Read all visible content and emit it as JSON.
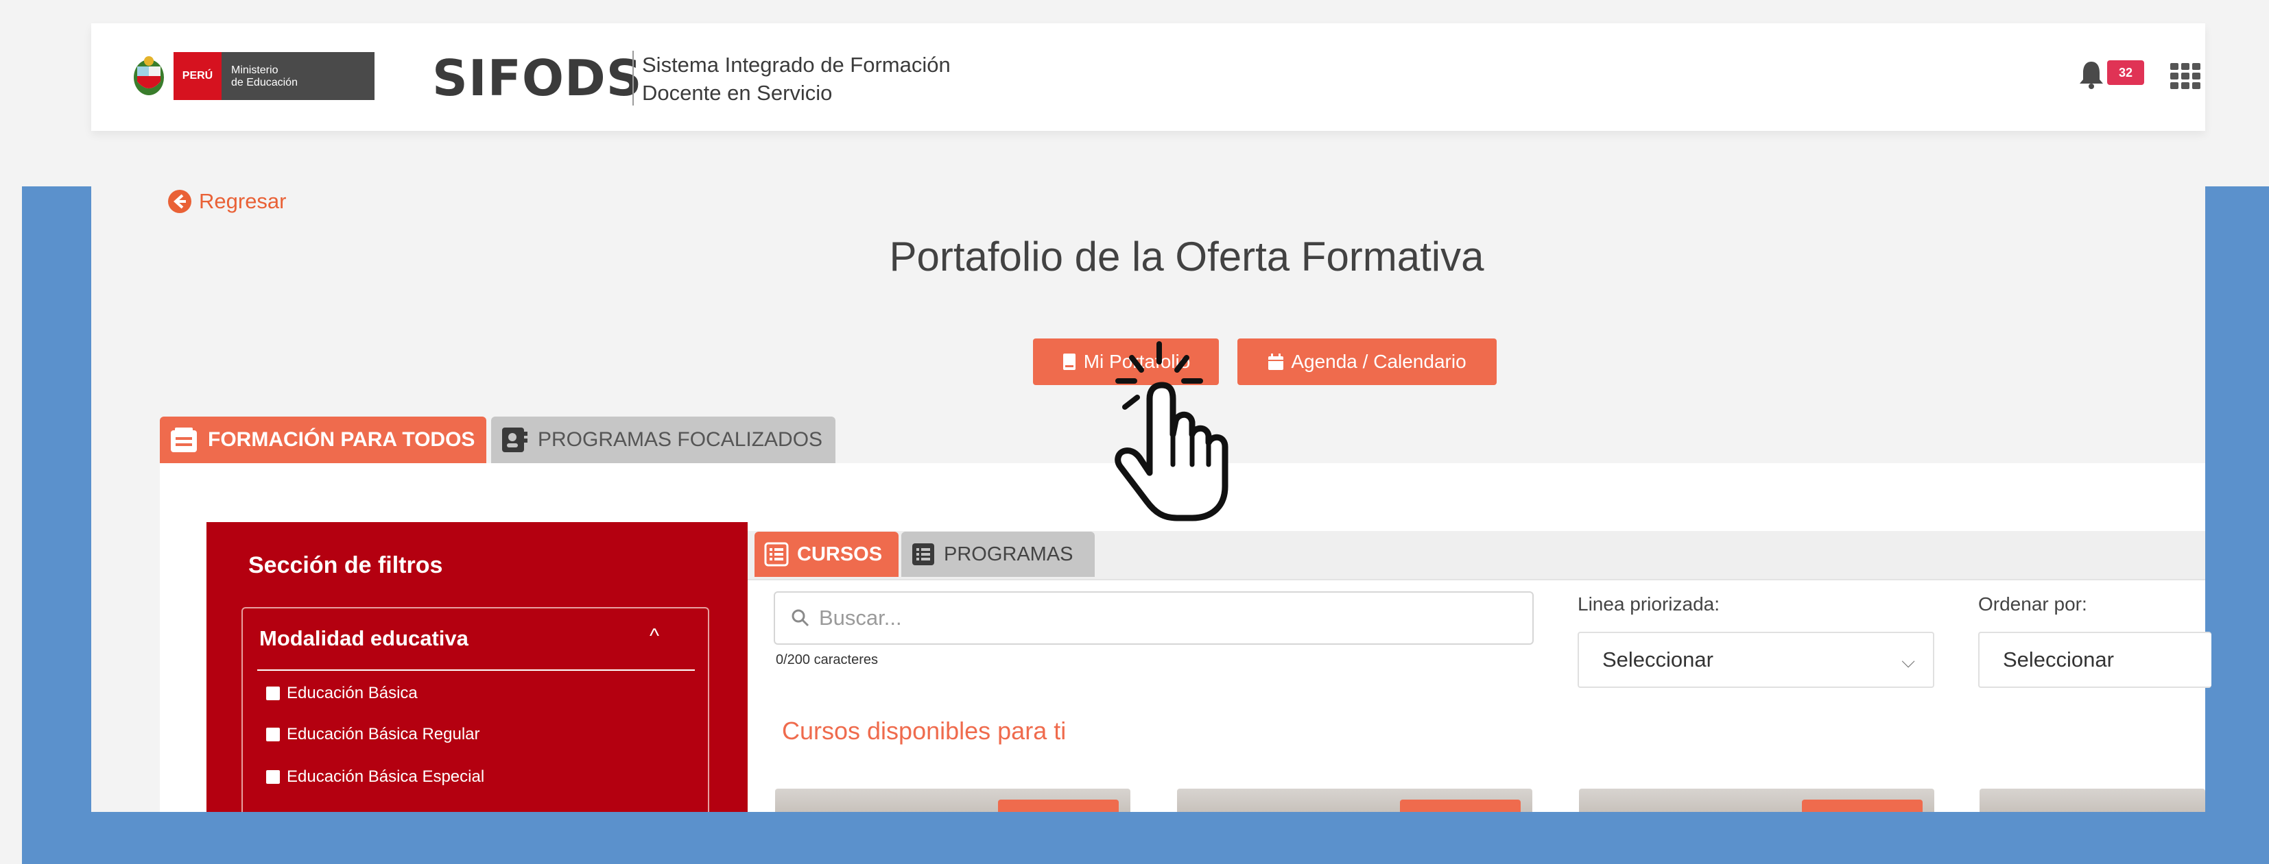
{
  "header": {
    "country": "PERÚ",
    "ministry_line1": "Ministerio",
    "ministry_line2": "de Educación",
    "brand": "SIFODS",
    "brand_sub_line1": "Sistema Integrado de Formación",
    "brand_sub_line2": "Docente en Servicio",
    "notifications_count": "32"
  },
  "nav": {
    "back_label": "Regresar"
  },
  "page": {
    "title": "Portafolio de la Oferta Formativa",
    "btn_portfolio": "Mi Portafolio",
    "btn_agenda": "Agenda / Calendario"
  },
  "main_tabs": [
    {
      "label": "FORMACIÓN PARA TODOS"
    },
    {
      "label": "PROGRAMAS FOCALIZADOS"
    }
  ],
  "filters": {
    "title": "Sección de filtros",
    "group": "Modalidad educativa",
    "options": [
      "Educación Básica",
      "Educación Básica Regular",
      "Educación Básica Especial"
    ]
  },
  "sub_tabs": [
    {
      "label": "CURSOS"
    },
    {
      "label": "PROGRAMAS"
    }
  ],
  "search": {
    "placeholder": "Buscar...",
    "counter": "0/200 caracteres"
  },
  "line_select": {
    "label": "Linea priorizada:",
    "value": "Seleccionar"
  },
  "order_select": {
    "label": "Ordenar por:",
    "value": "Seleccionar"
  },
  "courses": {
    "heading": "Cursos disponibles para ti"
  },
  "colors": {
    "accent": "#ef6b4d",
    "filter_bg": "#b40010",
    "frame_blue": "#5b91cc",
    "badge": "#e03355"
  },
  "icons": [
    "emblem-icon",
    "bell-icon",
    "apps-grid-icon",
    "back-arrow-icon",
    "book-icon",
    "calendar-icon",
    "tab-list-icon",
    "contact-book-icon",
    "search-icon",
    "chevron-up-icon",
    "chevron-down-icon",
    "hand-pointer-icon"
  ]
}
